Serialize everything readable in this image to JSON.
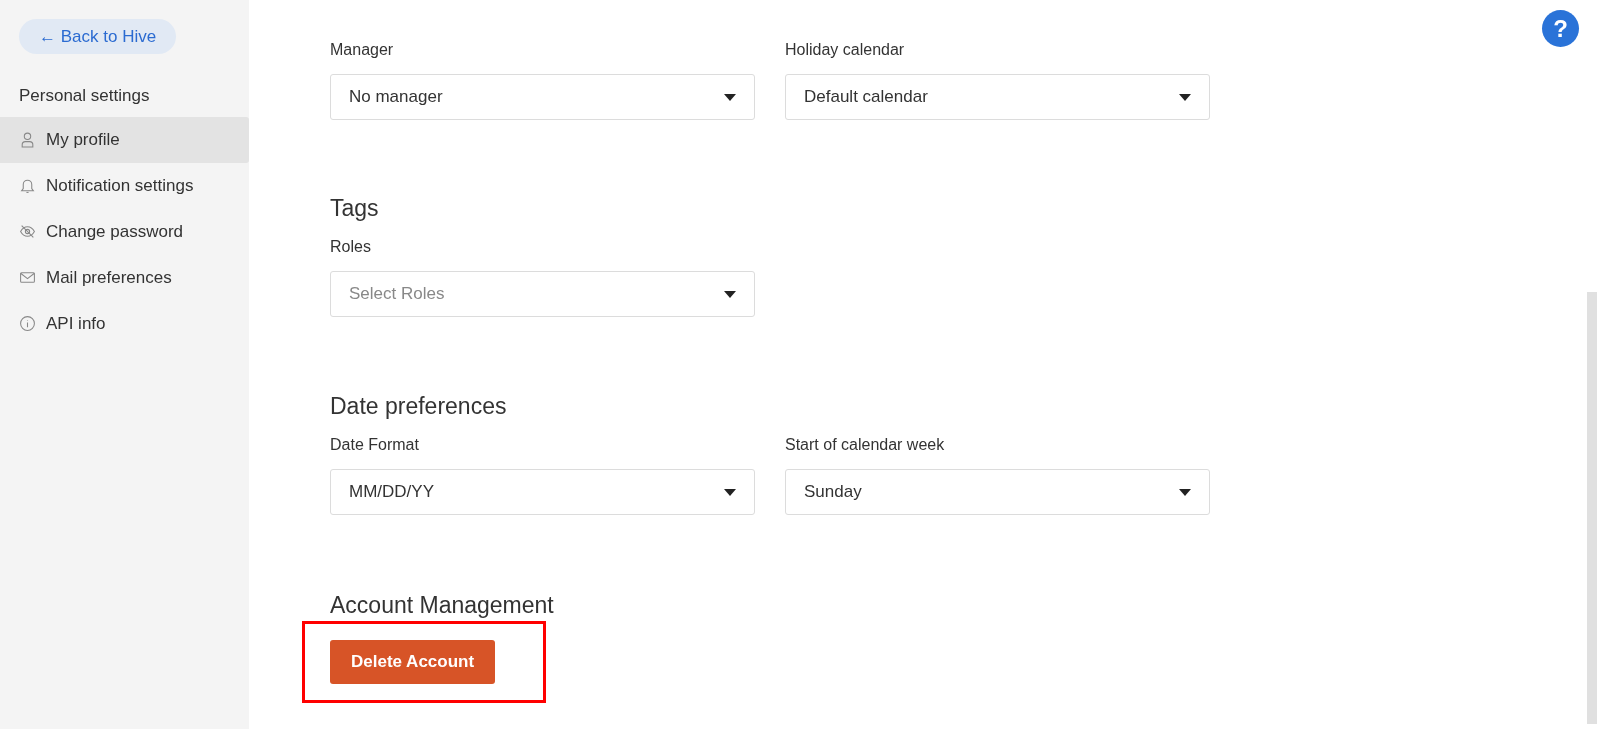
{
  "sidebar": {
    "back_button": "← Back to Hive",
    "section_title": "Personal settings",
    "items": [
      {
        "label": "My profile",
        "selected": true
      },
      {
        "label": "Notification settings",
        "selected": false
      },
      {
        "label": "Change password",
        "selected": false
      },
      {
        "label": "Mail preferences",
        "selected": false
      },
      {
        "label": "API info",
        "selected": false
      }
    ]
  },
  "help_button": "?",
  "sections": [
    {
      "fields": [
        {
          "label": "Manager",
          "value": "No manager"
        },
        {
          "label": "Holiday calendar",
          "value": "Default calendar"
        }
      ]
    },
    {
      "heading": "Tags",
      "fields": [
        {
          "label": "Roles",
          "placeholder": "Select Roles"
        }
      ]
    },
    {
      "heading": "Date preferences",
      "fields": [
        {
          "label": "Date Format",
          "value": "MM/DD/YY"
        },
        {
          "label": "Start of calendar week",
          "value": "Sunday"
        }
      ]
    },
    {
      "heading": "Account Management",
      "button": "Delete Account",
      "highlighted": true
    }
  ]
}
